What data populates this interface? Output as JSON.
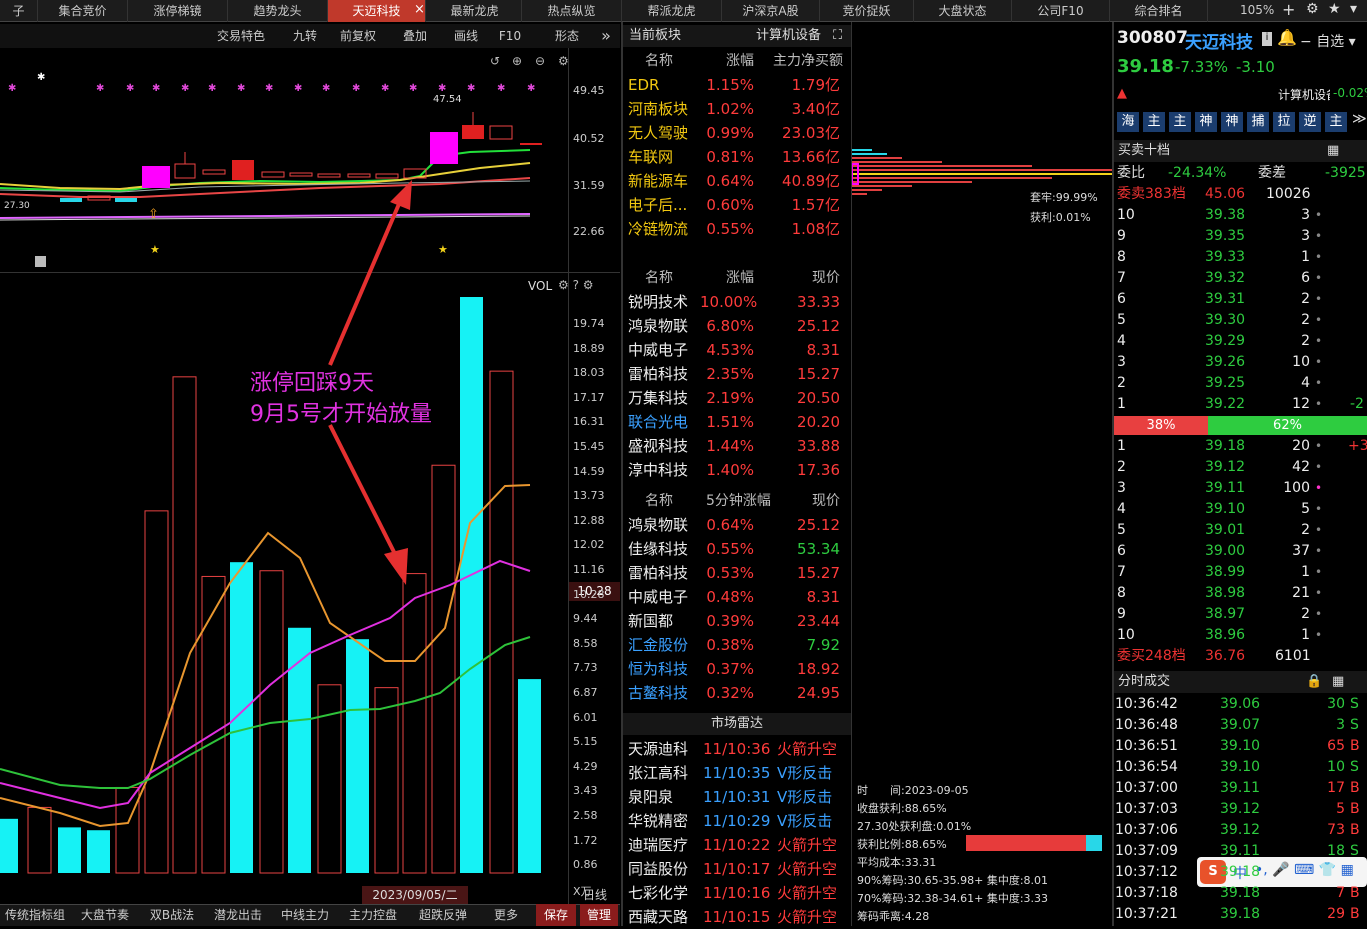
{
  "top_tabs": [
    {
      "label": "子"
    },
    {
      "label": "集合竞价"
    },
    {
      "label": "涨停梯镜"
    },
    {
      "label": "趋势龙头"
    },
    {
      "label": "天迈科技",
      "active": true
    },
    {
      "label": "最新龙虎"
    },
    {
      "label": "热点纵览"
    },
    {
      "label": "帮派龙虎"
    },
    {
      "label": "沪深京A股"
    },
    {
      "label": "竞价捉妖"
    },
    {
      "label": "大盘状态"
    },
    {
      "label": "公司F10"
    },
    {
      "label": "综合排名"
    }
  ],
  "zoom": "105%",
  "chart_toolbar": {
    "items": [
      "交易特色",
      "九转",
      "前复权",
      "叠加",
      "画线",
      "F10",
      "形态"
    ],
    "expand": "»"
  },
  "price_axis": [
    "49.45",
    "40.52",
    "31.59",
    "22.66"
  ],
  "price_labels": {
    "high": "47.54",
    "low": "27.30"
  },
  "vol_label": "VOL",
  "vol_axis": [
    "19.74",
    "18.89",
    "18.03",
    "17.17",
    "16.31",
    "15.45",
    "14.59",
    "13.73",
    "12.88",
    "12.02",
    "11.16",
    "10.28",
    "9.44",
    "8.58",
    "7.73",
    "6.87",
    "6.01",
    "5.15",
    "4.29",
    "3.43",
    "2.58",
    "1.72",
    "0.86",
    "X万"
  ],
  "vol_current": "10.28",
  "annotation": {
    "line1": "涨停回踩9天",
    "line2": "9月5号才开始放量"
  },
  "date_label": "2023/09/05/二",
  "period": "日线",
  "chart_data": {
    "type": "bar",
    "title": "VOL",
    "ylabel": "X万",
    "ylim": [
      0,
      20.2
    ],
    "values": [
      1.9,
      2.3,
      1.6,
      1.5,
      3.0,
      12.7,
      17.4,
      10.4,
      10.9,
      10.6,
      8.6,
      6.6,
      8.2,
      6.5,
      10.5,
      14.3,
      20.2,
      17.6,
      6.8
    ],
    "colors": [
      "cyan",
      "red",
      "cyan",
      "cyan",
      "red",
      "red",
      "red",
      "red",
      "cyan",
      "red",
      "cyan",
      "red",
      "cyan",
      "red",
      "red",
      "red",
      "cyan",
      "red",
      "cyan"
    ]
  },
  "bottom_tabs": [
    "传统指标组",
    "大盘节奏",
    "双B战法",
    "潜龙出击",
    "中线主力",
    "主力控盘",
    "超跌反弹",
    "更多",
    "保存",
    "管理"
  ],
  "sector": {
    "title": "当前板块",
    "name": "计算机设备",
    "cols": [
      "名称",
      "涨幅",
      "主力净买额"
    ],
    "rows": [
      [
        "EDR",
        "1.15%",
        "1.79亿"
      ],
      [
        "河南板块",
        "1.02%",
        "3.40亿"
      ],
      [
        "无人驾驶",
        "0.99%",
        "23.03亿"
      ],
      [
        "车联网",
        "0.81%",
        "13.66亿"
      ],
      [
        "新能源车",
        "0.64%",
        "40.89亿"
      ],
      [
        "电子后...",
        "0.60%",
        "1.57亿"
      ],
      [
        "冷链物流",
        "0.55%",
        "1.08亿"
      ]
    ]
  },
  "stocks": {
    "cols": [
      "名称",
      "涨幅",
      "现价"
    ],
    "rows": [
      [
        "锐明技术",
        "10.00%",
        "33.33"
      ],
      [
        "鸿泉物联",
        "6.80%",
        "25.12"
      ],
      [
        "中威电子",
        "4.53%",
        "8.31"
      ],
      [
        "雷柏科技",
        "2.35%",
        "15.27"
      ],
      [
        "万集科技",
        "2.19%",
        "20.50"
      ],
      [
        "联合光电",
        "1.51%",
        "20.20"
      ],
      [
        "盛视科技",
        "1.44%",
        "33.88"
      ],
      [
        "淳中科技",
        "1.40%",
        "17.36"
      ]
    ]
  },
  "stocks5": {
    "cols": [
      "名称",
      "5分钟涨幅",
      "现价"
    ],
    "rows": [
      [
        "鸿泉物联",
        "0.64%",
        "25.12"
      ],
      [
        "佳缘科技",
        "0.55%",
        "53.34"
      ],
      [
        "雷柏科技",
        "0.53%",
        "15.27"
      ],
      [
        "中威电子",
        "0.48%",
        "8.31"
      ],
      [
        "新国都",
        "0.39%",
        "23.44"
      ],
      [
        "汇金股份",
        "0.38%",
        "7.92"
      ],
      [
        "恒为科技",
        "0.37%",
        "18.92"
      ],
      [
        "古鳌科技",
        "0.32%",
        "24.95"
      ]
    ]
  },
  "radar": {
    "title": "市场雷达",
    "rows": [
      [
        "天源迪科",
        "11/10:36",
        "火箭升空"
      ],
      [
        "张江高科",
        "11/10:35",
        "V形反击"
      ],
      [
        "泉阳泉",
        "11/10:31",
        "V形反击"
      ],
      [
        "华锐精密",
        "11/10:29",
        "V形反击"
      ],
      [
        "迪瑞医疗",
        "11/10:22",
        "火箭升空"
      ],
      [
        "同益股份",
        "11/10:17",
        "火箭升空"
      ],
      [
        "七彩化学",
        "11/10:16",
        "火箭升空"
      ],
      [
        "西藏天路",
        "11/10:15",
        "火箭升空"
      ]
    ]
  },
  "chips": {
    "trap": "套牢:99.99%",
    "profit": "获利:0.01%",
    "lines": [
      "时　　间:2023-09-05",
      "收盘获利:88.65%",
      "27.30处获利盘:0.01%",
      "获利比例:88.65%",
      "平均成本:33.31",
      "90%筹码:30.65-35.98+ 集中度:8.01",
      "70%筹码:32.38-34.61+ 集中度:3.33",
      "筹码乖离:4.28"
    ]
  },
  "quote": {
    "code": "300807",
    "name": "天迈科技",
    "price": "39.18",
    "pct": "-7.33%",
    "chg": "-3.10",
    "self": "自选",
    "sector": "计算机设备",
    "sector_pct": "-0.02%",
    "tags": [
      "海",
      "主",
      "主",
      "神",
      "神",
      "捕",
      "拉",
      "逆",
      "主"
    ]
  },
  "orderbook": {
    "title": "买卖十档",
    "weibi_label": "委比",
    "weibi": "-24.34%",
    "weicha_label": "委差",
    "weicha": "-3925",
    "sell_sum": {
      "label": "委卖383档",
      "price": "45.06",
      "vol": "10026"
    },
    "sells": [
      [
        "10",
        "39.38",
        "3"
      ],
      [
        "9",
        "39.35",
        "3"
      ],
      [
        "8",
        "39.33",
        "1"
      ],
      [
        "7",
        "39.32",
        "6"
      ],
      [
        "6",
        "39.31",
        "2"
      ],
      [
        "5",
        "39.30",
        "2"
      ],
      [
        "4",
        "39.29",
        "2"
      ],
      [
        "3",
        "39.26",
        "10"
      ],
      [
        "2",
        "39.25",
        "4"
      ],
      [
        "1",
        "39.22",
        "12"
      ]
    ],
    "sell_extra": "-2",
    "ratio_sell": "38%",
    "ratio_buy": "62%",
    "buys": [
      [
        "1",
        "39.18",
        "20"
      ],
      [
        "2",
        "39.12",
        "42"
      ],
      [
        "3",
        "39.11",
        "100"
      ],
      [
        "4",
        "39.10",
        "5"
      ],
      [
        "5",
        "39.01",
        "2"
      ],
      [
        "6",
        "39.00",
        "37"
      ],
      [
        "7",
        "38.99",
        "1"
      ],
      [
        "8",
        "38.98",
        "21"
      ],
      [
        "9",
        "38.97",
        "2"
      ],
      [
        "10",
        "38.96",
        "1"
      ]
    ],
    "buy_extra": "+3",
    "buy_sum": {
      "label": "委买248档",
      "price": "36.76",
      "vol": "6101"
    }
  },
  "ticks": {
    "title": "分时成交",
    "rows": [
      [
        "10:36:42",
        "39.06",
        "30",
        "S"
      ],
      [
        "10:36:48",
        "39.07",
        "3",
        "S"
      ],
      [
        "10:36:51",
        "39.10",
        "65",
        "B"
      ],
      [
        "10:36:54",
        "39.10",
        "10",
        "S"
      ],
      [
        "10:37:00",
        "39.11",
        "17",
        "B"
      ],
      [
        "10:37:03",
        "39.12",
        "5",
        "B"
      ],
      [
        "10:37:06",
        "39.12",
        "73",
        "B"
      ],
      [
        "10:37:09",
        "39.11",
        "18",
        "S"
      ],
      [
        "10:37:12",
        "39.18",
        "",
        ""
      ],
      [
        "10:37:18",
        "39.18",
        "7",
        "B"
      ],
      [
        "10:37:21",
        "39.18",
        "29",
        "B"
      ]
    ]
  },
  "ime": {
    "label": "中"
  }
}
